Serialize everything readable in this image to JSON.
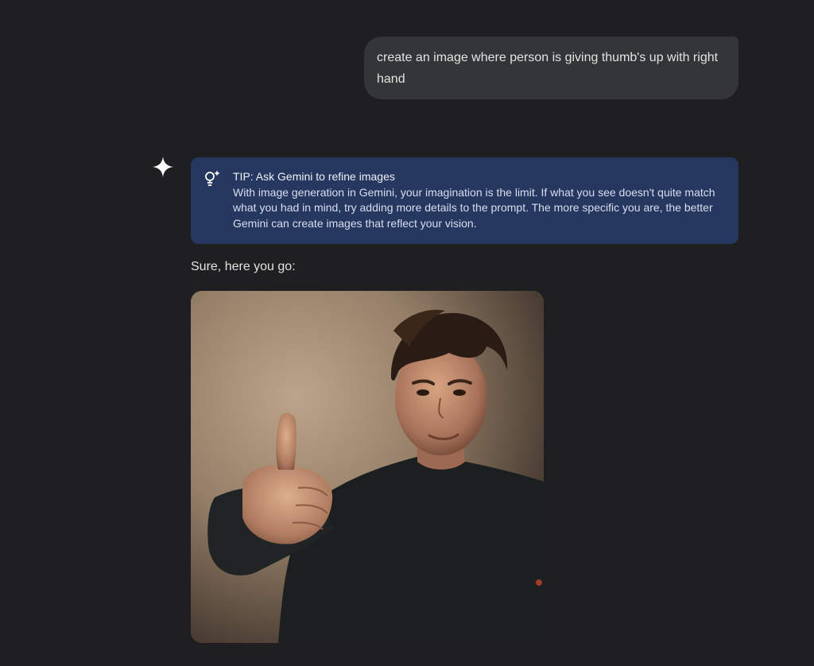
{
  "conversation": {
    "user_prompt": "create an image where person is giving thumb's up with right hand",
    "tip": {
      "title": "TIP: Ask Gemini to refine images",
      "body": "With image generation in Gemini, your imagination is the limit. If what you see doesn't quite match what you had in mind, try adding more details to the prompt. The more specific you are, the better Gemini can create images that reflect your vision.",
      "icon": "lightbulb-sparkle-icon"
    },
    "reply_text": "Sure, here you go:",
    "generated_image": {
      "icon": "generated-image",
      "subject": "young man giving thumbs up"
    }
  },
  "colors": {
    "background": "#1f1f21",
    "user_bubble": "#333537",
    "tip_card": "#263760",
    "text": "#e3e3e3"
  }
}
